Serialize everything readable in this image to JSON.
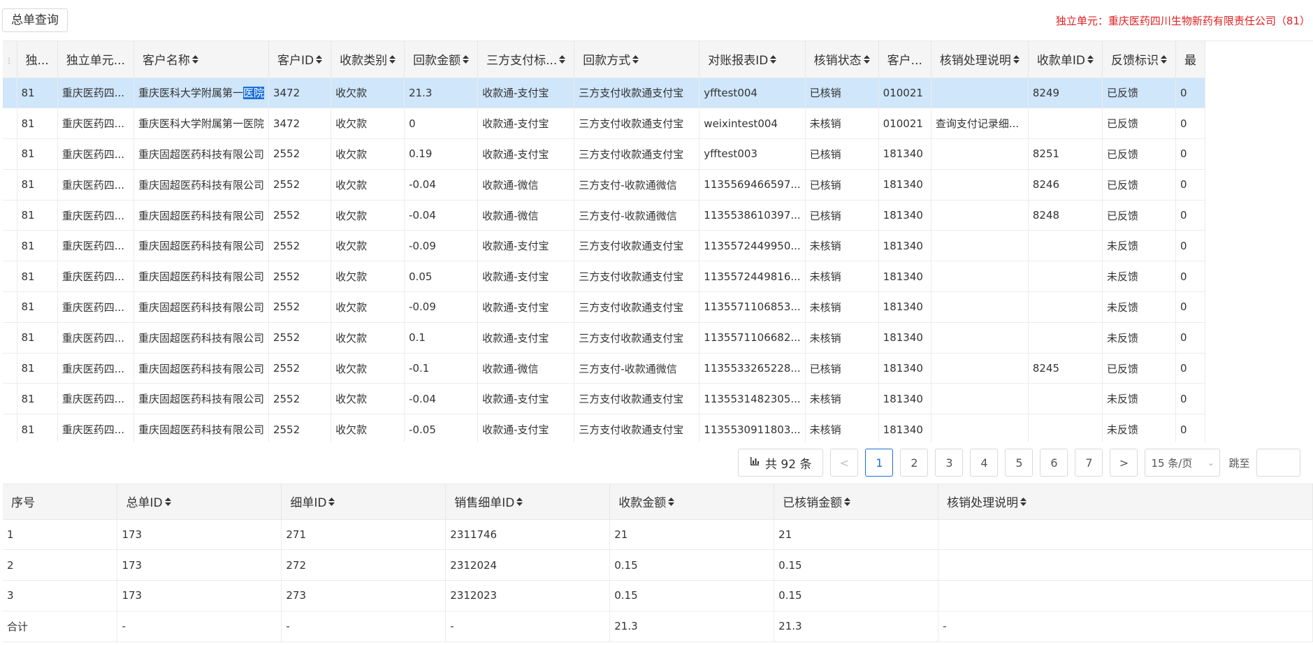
{
  "topbar": {
    "summary_button": "总单查询",
    "unit_info": "独立单元：重庆医药四川生物新药有限责任公司（81）"
  },
  "master": {
    "columns": [
      "独...",
      "独立单元...",
      "客户名称",
      "客户ID",
      "收款类别",
      "回款金额",
      "三方支付标...",
      "回款方式",
      "对账报表ID",
      "核销状态",
      "客户...",
      "核销处理说明",
      "收款单ID",
      "反馈标识",
      "最"
    ],
    "sortable": [
      false,
      false,
      true,
      true,
      true,
      true,
      true,
      true,
      true,
      true,
      false,
      true,
      true,
      true,
      false
    ],
    "selected_row": 0,
    "selected_text": "医院",
    "rows": [
      {
        "unit_id": "81",
        "unit": "重庆医药四...",
        "customer": "重庆医科大学附属第一",
        "customer_tail": "医院",
        "cust_id": "3472",
        "category": "收欠款",
        "amount": "21.3",
        "pay_flag": "收款通-支付宝",
        "method": "三方支付收款通支付宝",
        "report_id": "yfftest004",
        "status": "已核销",
        "cust_code": "010021",
        "note": "",
        "receipt_id": "8249",
        "feedback": "已反馈",
        "last": "0"
      },
      {
        "unit_id": "81",
        "unit": "重庆医药四...",
        "customer": "重庆医科大学附属第一医院",
        "customer_tail": "",
        "cust_id": "3472",
        "category": "收欠款",
        "amount": "0",
        "pay_flag": "收款通-支付宝",
        "method": "三方支付收款通支付宝",
        "report_id": "weixintest004",
        "status": "未核销",
        "cust_code": "010021",
        "note": "查询支付记录细...",
        "receipt_id": "",
        "feedback": "已反馈",
        "last": "0"
      },
      {
        "unit_id": "81",
        "unit": "重庆医药四...",
        "customer": "重庆固超医药科技有限公司",
        "customer_tail": "",
        "cust_id": "2552",
        "category": "收欠款",
        "amount": "0.19",
        "pay_flag": "收款通-支付宝",
        "method": "三方支付收款通支付宝",
        "report_id": "yfftest003",
        "status": "已核销",
        "cust_code": "181340",
        "note": "",
        "receipt_id": "8251",
        "feedback": "已反馈",
        "last": "0"
      },
      {
        "unit_id": "81",
        "unit": "重庆医药四...",
        "customer": "重庆固超医药科技有限公司",
        "customer_tail": "",
        "cust_id": "2552",
        "category": "收欠款",
        "amount": "-0.04",
        "pay_flag": "收款通-微信",
        "method": "三方支付-收款通微信",
        "report_id": "1135569466597...",
        "status": "已核销",
        "cust_code": "181340",
        "note": "",
        "receipt_id": "8246",
        "feedback": "已反馈",
        "last": "0"
      },
      {
        "unit_id": "81",
        "unit": "重庆医药四...",
        "customer": "重庆固超医药科技有限公司",
        "customer_tail": "",
        "cust_id": "2552",
        "category": "收欠款",
        "amount": "-0.04",
        "pay_flag": "收款通-微信",
        "method": "三方支付-收款通微信",
        "report_id": "1135538610397...",
        "status": "已核销",
        "cust_code": "181340",
        "note": "",
        "receipt_id": "8248",
        "feedback": "已反馈",
        "last": "0"
      },
      {
        "unit_id": "81",
        "unit": "重庆医药四...",
        "customer": "重庆固超医药科技有限公司",
        "customer_tail": "",
        "cust_id": "2552",
        "category": "收欠款",
        "amount": "-0.09",
        "pay_flag": "收款通-支付宝",
        "method": "三方支付收款通支付宝",
        "report_id": "1135572449950...",
        "status": "未核销",
        "cust_code": "181340",
        "note": "",
        "receipt_id": "",
        "feedback": "未反馈",
        "last": "0"
      },
      {
        "unit_id": "81",
        "unit": "重庆医药四...",
        "customer": "重庆固超医药科技有限公司",
        "customer_tail": "",
        "cust_id": "2552",
        "category": "收欠款",
        "amount": "0.05",
        "pay_flag": "收款通-支付宝",
        "method": "三方支付收款通支付宝",
        "report_id": "1135572449816...",
        "status": "未核销",
        "cust_code": "181340",
        "note": "",
        "receipt_id": "",
        "feedback": "未反馈",
        "last": "0"
      },
      {
        "unit_id": "81",
        "unit": "重庆医药四...",
        "customer": "重庆固超医药科技有限公司",
        "customer_tail": "",
        "cust_id": "2552",
        "category": "收欠款",
        "amount": "-0.09",
        "pay_flag": "收款通-支付宝",
        "method": "三方支付收款通支付宝",
        "report_id": "1135571106853...",
        "status": "未核销",
        "cust_code": "181340",
        "note": "",
        "receipt_id": "",
        "feedback": "未反馈",
        "last": "0"
      },
      {
        "unit_id": "81",
        "unit": "重庆医药四...",
        "customer": "重庆固超医药科技有限公司",
        "customer_tail": "",
        "cust_id": "2552",
        "category": "收欠款",
        "amount": "0.1",
        "pay_flag": "收款通-支付宝",
        "method": "三方支付收款通支付宝",
        "report_id": "1135571106682...",
        "status": "未核销",
        "cust_code": "181340",
        "note": "",
        "receipt_id": "",
        "feedback": "未反馈",
        "last": "0"
      },
      {
        "unit_id": "81",
        "unit": "重庆医药四...",
        "customer": "重庆固超医药科技有限公司",
        "customer_tail": "",
        "cust_id": "2552",
        "category": "收欠款",
        "amount": "-0.1",
        "pay_flag": "收款通-微信",
        "method": "三方支付-收款通微信",
        "report_id": "1135533265228...",
        "status": "已核销",
        "cust_code": "181340",
        "note": "",
        "receipt_id": "8245",
        "feedback": "已反馈",
        "last": "0"
      },
      {
        "unit_id": "81",
        "unit": "重庆医药四...",
        "customer": "重庆固超医药科技有限公司",
        "customer_tail": "",
        "cust_id": "2552",
        "category": "收欠款",
        "amount": "-0.04",
        "pay_flag": "收款通-支付宝",
        "method": "三方支付收款通支付宝",
        "report_id": "1135531482305...",
        "status": "未核销",
        "cust_code": "181340",
        "note": "",
        "receipt_id": "",
        "feedback": "未反馈",
        "last": "0"
      },
      {
        "unit_id": "81",
        "unit": "重庆医药四...",
        "customer": "重庆固超医药科技有限公司",
        "customer_tail": "",
        "cust_id": "2552",
        "category": "收欠款",
        "amount": "-0.05",
        "pay_flag": "收款通-支付宝",
        "method": "三方支付收款通支付宝",
        "report_id": "1135530911803...",
        "status": "未核销",
        "cust_code": "181340",
        "note": "",
        "receipt_id": "",
        "feedback": "未反馈",
        "last": "0"
      }
    ]
  },
  "pagination": {
    "total": "共 92 条",
    "prev": "<",
    "pages": [
      "1",
      "2",
      "3",
      "4",
      "5",
      "6",
      "7"
    ],
    "active_page": "1",
    "next": ">",
    "page_size": "15 条/页",
    "jump_label": "跳至"
  },
  "detail": {
    "columns": [
      "序号",
      "总单ID",
      "细单ID",
      "销售细单ID",
      "收款金额",
      "已核销金额",
      "核销处理说明"
    ],
    "sortable": [
      false,
      true,
      true,
      true,
      true,
      true,
      true
    ],
    "rows": [
      [
        "1",
        "173",
        "271",
        "2311746",
        "21",
        "21",
        ""
      ],
      [
        "2",
        "173",
        "272",
        "2312024",
        "0.15",
        "0.15",
        ""
      ],
      [
        "3",
        "173",
        "273",
        "2312023",
        "0.15",
        "0.15",
        ""
      ],
      [
        "合计",
        "-",
        "-",
        "-",
        "21.3",
        "21.3",
        "-"
      ]
    ]
  },
  "colors": {
    "accent": "#1a6fd6",
    "selected_row": "#cfe6fb",
    "header_bg": "#f5f5f5",
    "alert_text": "#e02020"
  }
}
